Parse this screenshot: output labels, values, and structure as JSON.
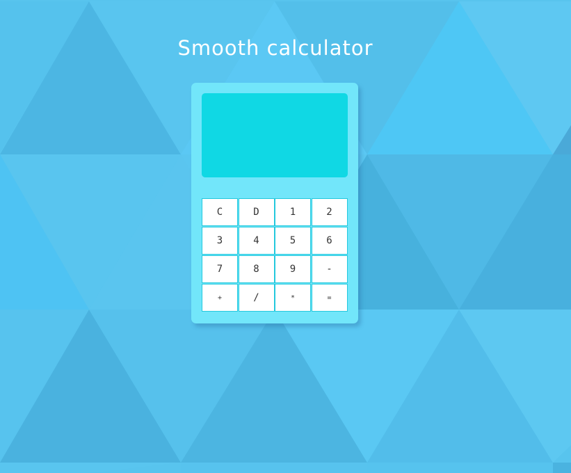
{
  "page": {
    "title": "Smooth calculator"
  },
  "calculator": {
    "display_value": "",
    "keys": [
      "C",
      "D",
      "1",
      "2",
      "3",
      "4",
      "5",
      "6",
      "7",
      "8",
      "9",
      "-",
      "+",
      "/",
      "*",
      "="
    ]
  },
  "colors": {
    "background": "#58c4ee",
    "calculator_body": "#72e6fa",
    "display": "#10d8e4",
    "key_border": "#23c9dd",
    "key_bg": "#ffffff",
    "title": "#ffffff"
  }
}
